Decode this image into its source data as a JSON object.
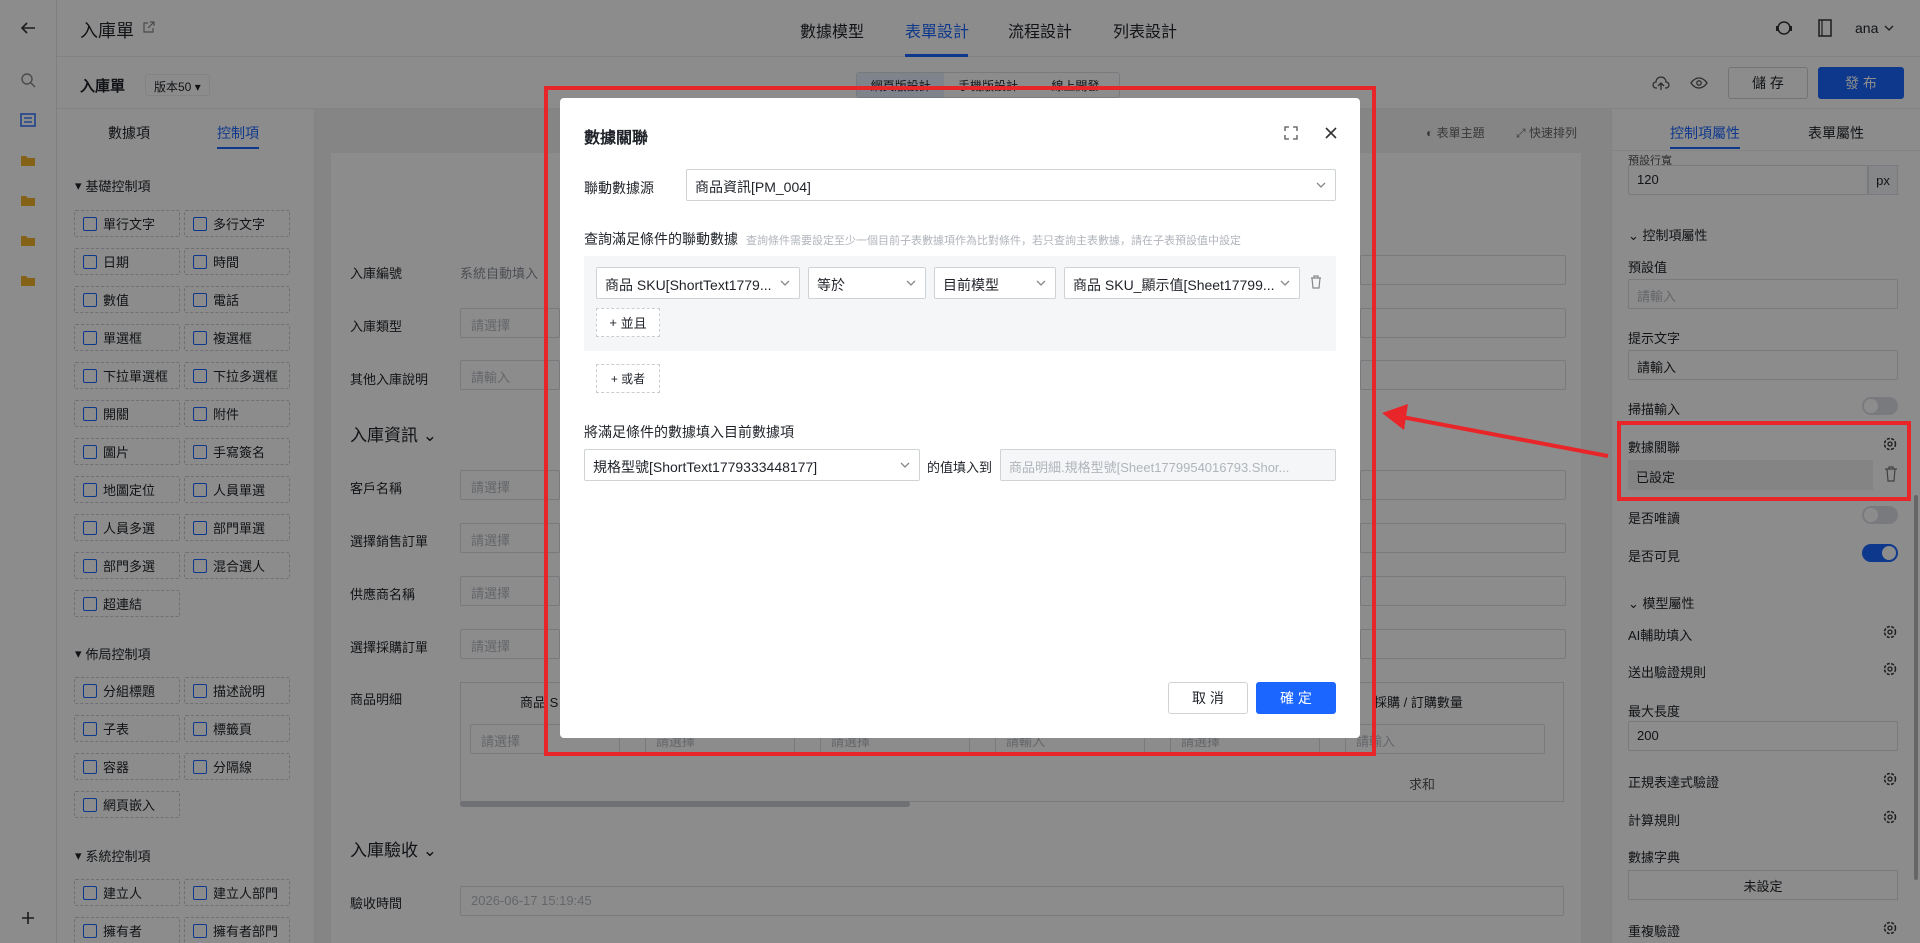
{
  "topbar": {
    "title": "入庫單",
    "tabs": [
      "數據模型",
      "表單設計",
      "流程設計",
      "列表設計"
    ],
    "active_tab": "表單設計",
    "user": "ana"
  },
  "subbar": {
    "form_name": "入庫單",
    "version": "版本50",
    "sub_tabs": [
      "網頁版設計",
      "手機版設計",
      "線上開發"
    ],
    "save_label": "儲 存",
    "publish_label": "發 布"
  },
  "leftpanel": {
    "tabs": [
      "數據項",
      "控制項"
    ],
    "basic_title": "基礎控制項",
    "basic": [
      "單行文字",
      "多行文字",
      "日期",
      "時間",
      "數值",
      "電話",
      "單選框",
      "複選框",
      "下拉單選框",
      "下拉多選框",
      "開關",
      "附件",
      "圖片",
      "手寫簽名",
      "地圖定位",
      "人員單選",
      "人員多選",
      "部門單選",
      "部門多選",
      "混合選人",
      "超連結"
    ],
    "layout_title": "佈局控制項",
    "layout": [
      "分組標題",
      "描述說明",
      "子表",
      "標籤頁",
      "容器",
      "分隔線",
      "網頁嵌入"
    ],
    "system_title": "系統控制項",
    "system": [
      "建立人",
      "建立人部門",
      "擁有者",
      "擁有者部門"
    ]
  },
  "canvas": {
    "toolbar": [
      "表單主題",
      "快速排列"
    ],
    "fields": [
      {
        "label": "入庫編號",
        "value": "系統自動填入"
      },
      {
        "label": "入庫類型",
        "value": "請選擇"
      },
      {
        "label": "其他入庫說明",
        "value": "請輸入"
      }
    ],
    "section1": "入庫資訊",
    "fields2": [
      {
        "label": "客戶名稱",
        "value": "請選擇"
      },
      {
        "label": "選擇銷售訂單",
        "value": "請選擇"
      },
      {
        "label": "供應商名稱",
        "value": "請選擇"
      },
      {
        "label": "選擇採購訂單",
        "value": "請選擇"
      }
    ],
    "detail_label": "商品明細",
    "detail_col1": "商品 S",
    "detail_col_last": "採購 / 訂購數量",
    "detail_placeholders": [
      "請選擇",
      "請選擇",
      "請選擇",
      "請輸入",
      "請選擇",
      "請輸入"
    ],
    "sum_label": "求和",
    "section2": "入庫驗收",
    "receive_label": "驗收時間",
    "receive_value": "2026-06-17 15:19:45"
  },
  "rightpanel": {
    "tabs": [
      "控制項屬性",
      "表單屬性"
    ],
    "preset_label": "預設行寬",
    "preset_value": "120",
    "preset_unit": "px",
    "ctrl_attr_title": "控制項屬性",
    "default_label": "預設值",
    "default_placeholder": "請輸入",
    "hint_label": "提示文字",
    "hint_value": "請輸入",
    "scan_label": "掃描輸入",
    "link_label": "數據關聯",
    "link_value": "已設定",
    "readonly_label": "是否唯讀",
    "visible_label": "是否可見",
    "model_attr_title": "模型屬性",
    "ai_label": "AI輔助填入",
    "submit_rule_label": "送出驗證規則",
    "maxlen_label": "最大長度",
    "maxlen_value": "200",
    "regex_label": "正規表達式驗證",
    "calc_label": "計算規則",
    "dict_label": "數據字典",
    "dict_value": "未設定",
    "dup_label": "重複驗證"
  },
  "modal": {
    "title": "數據關聯",
    "source_label": "聯動數據源",
    "source_value": "商品資訊[PM_004]",
    "query_label": "查詢滿足條件的聯動數據",
    "query_hint": "查詢條件需要設定至少一個目前子表數據項作為比對條件，若只查詢主表數據，請在子表預設值中設定",
    "cond_field": "商品 SKU[ShortText1779...",
    "cond_op": "等於",
    "cond_type": "目前模型",
    "cond_value": "商品 SKU_顯示值[Sheet17799...",
    "and_label": "並且",
    "or_label": "或者",
    "fill_label": "將滿足條件的數據填入目前數據項",
    "fill_source": "規格型號[ShortText1779333448177]",
    "fill_to_label": "的值填入到",
    "fill_target": "商品明細.規格型號[Sheet1779954016793.Shor...",
    "cancel_label": "取 消",
    "confirm_label": "確 定"
  },
  "colors": {
    "accent": "#1a66ff",
    "annotation": "#e8262a"
  }
}
